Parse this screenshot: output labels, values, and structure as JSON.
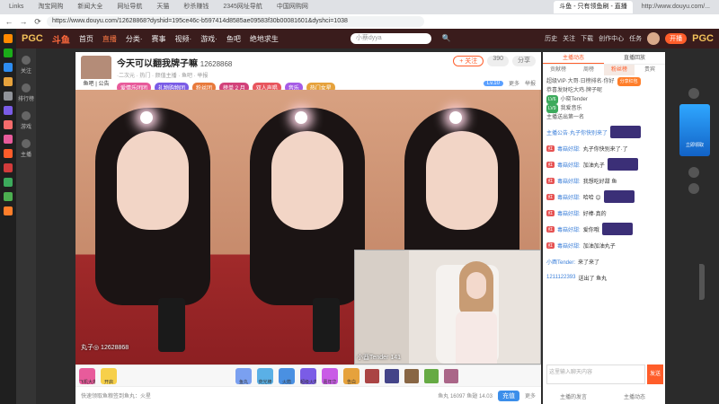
{
  "browser": {
    "tabs": [
      "Links",
      "淘宝网购",
      "新闻大全",
      "网址导航",
      "天猫",
      "秒杀赚钱",
      "2345网址导航",
      "中国网购网"
    ],
    "active_tab": "斗鱼 - 只有领鱼刷 - 直播",
    "right_tab": "http://www.douyu.com/...",
    "url": "https://www.douyu.com/12628868?dyshid=195ce46c-b597414d8585ae09583f30b00081601&dyshci=1038",
    "nav": {
      "back": "←",
      "forward": "→",
      "reload": "⟳"
    }
  },
  "site": {
    "logo": "PGC",
    "logo2": "斗鱼",
    "nav": [
      "首页",
      "直播",
      "分类·",
      "赛事",
      "视频·",
      "游戏·",
      "鱼吧",
      "绝地求生"
    ],
    "active_nav": "直播",
    "search_placeholder": "小蔡dyya",
    "search_icon": "🔍",
    "header_right": [
      "历史",
      "关注",
      "下载",
      "创作中心",
      "任务"
    ],
    "login_label": "开播"
  },
  "left_side": [
    "关注",
    "排行榜",
    "游戏",
    "主播"
  ],
  "room": {
    "title": "今天可以翻我牌子嘛",
    "room_id": "12628868",
    "sub": "·二次元 · 热门 · 颜值主播 · 鱼吧 · 举报",
    "anchor_badge": "鱼吧 | 公告",
    "tags": [
      {
        "label": "爱情乐团团",
        "color": "#e85b9b"
      },
      {
        "label": "礼物购物团",
        "color": "#7a5ce6"
      },
      {
        "label": "粉丝团",
        "color": "#e87a3c"
      },
      {
        "label": "榜单 2 月",
        "color": "#d2427a"
      },
      {
        "label": "双人声唱",
        "color": "#e8565e"
      },
      {
        "label": "音乐",
        "color": "#a65ce6"
      },
      {
        "label": "热门女星",
        "color": "#e6a23c"
      }
    ],
    "follow_label": "+ 关注",
    "fans_count": "390",
    "share_label": "分享",
    "level": "Lv.10",
    "head_links": [
      "更多",
      "举报"
    ]
  },
  "video": {
    "anchor_label": "丸子◎ 12628868",
    "pip_label": "小酉Tender  141"
  },
  "gifts": [
    "飞机大炮",
    "开启",
    "鱼丸",
    "荧光棒",
    "火箭",
    "超级火箭",
    "嘉年华",
    "告白"
  ],
  "info": {
    "text": "快速领取鱼粮签到鱼丸：火星",
    "stats": "鱼丸 16097  鱼翅 14.03",
    "recharge": "充值",
    "more": "更多"
  },
  "chat": {
    "tabs": [
      "主播动态",
      "直播回放"
    ],
    "tabs2": [
      "贡献榜",
      "周榜",
      "粉丝榜",
      "贵宾"
    ],
    "active_tab2": "粉丝榜",
    "rank_rows": [
      {
        "text": "超级VIP·大哥·日榜排名·你好",
        "pill": "分享红包"
      },
      {
        "text": "恭喜发财吃大鸡·牌子呢",
        "pill": ""
      },
      {
        "text": "小晓Tender",
        "lvl": "LV6"
      },
      {
        "text": "我爱音乐",
        "lvl": "LV9"
      },
      {
        "text": "主播送出第一名",
        "pill": ""
      }
    ],
    "messages": [
      {
        "name": "主播公告·丸子你快别来了",
        "body": "",
        "badge": "",
        "thumb": true
      },
      {
        "name": "毒菇好甜:",
        "body": "丸子你快别来了·了",
        "badge": "红"
      },
      {
        "name": "毒菇好甜:",
        "body": "加油丸子",
        "badge": "红",
        "thumb": true
      },
      {
        "name": "毒菇好甜:",
        "body": "我想吃好甜 鱼",
        "badge": "红"
      },
      {
        "name": "毒菇好甜:",
        "body": "哈哈 😊",
        "badge": "红",
        "thumb": true
      },
      {
        "name": "毒菇好甜:",
        "body": "好棒·真的",
        "badge": "红"
      },
      {
        "name": "毒菇好甜:",
        "body": "爱你哦",
        "badge": "红",
        "thumb": true
      },
      {
        "name": "毒菇好甜:",
        "body": "加油加油丸子",
        "badge": "红"
      },
      {
        "name": "小酉Tender:",
        "body": "来了来了",
        "badge": ""
      },
      {
        "name": "1211122393",
        "body": "送出了 鱼丸",
        "badge": ""
      }
    ],
    "input_placeholder": "这里输入聊天内容",
    "send_label": "发送",
    "footer": [
      "主播的发言",
      "主播动态"
    ]
  },
  "promo": {
    "label": "立即领取"
  },
  "colors": {
    "accent": "#ff5d2a",
    "header_bg": "#3a1c1c"
  }
}
